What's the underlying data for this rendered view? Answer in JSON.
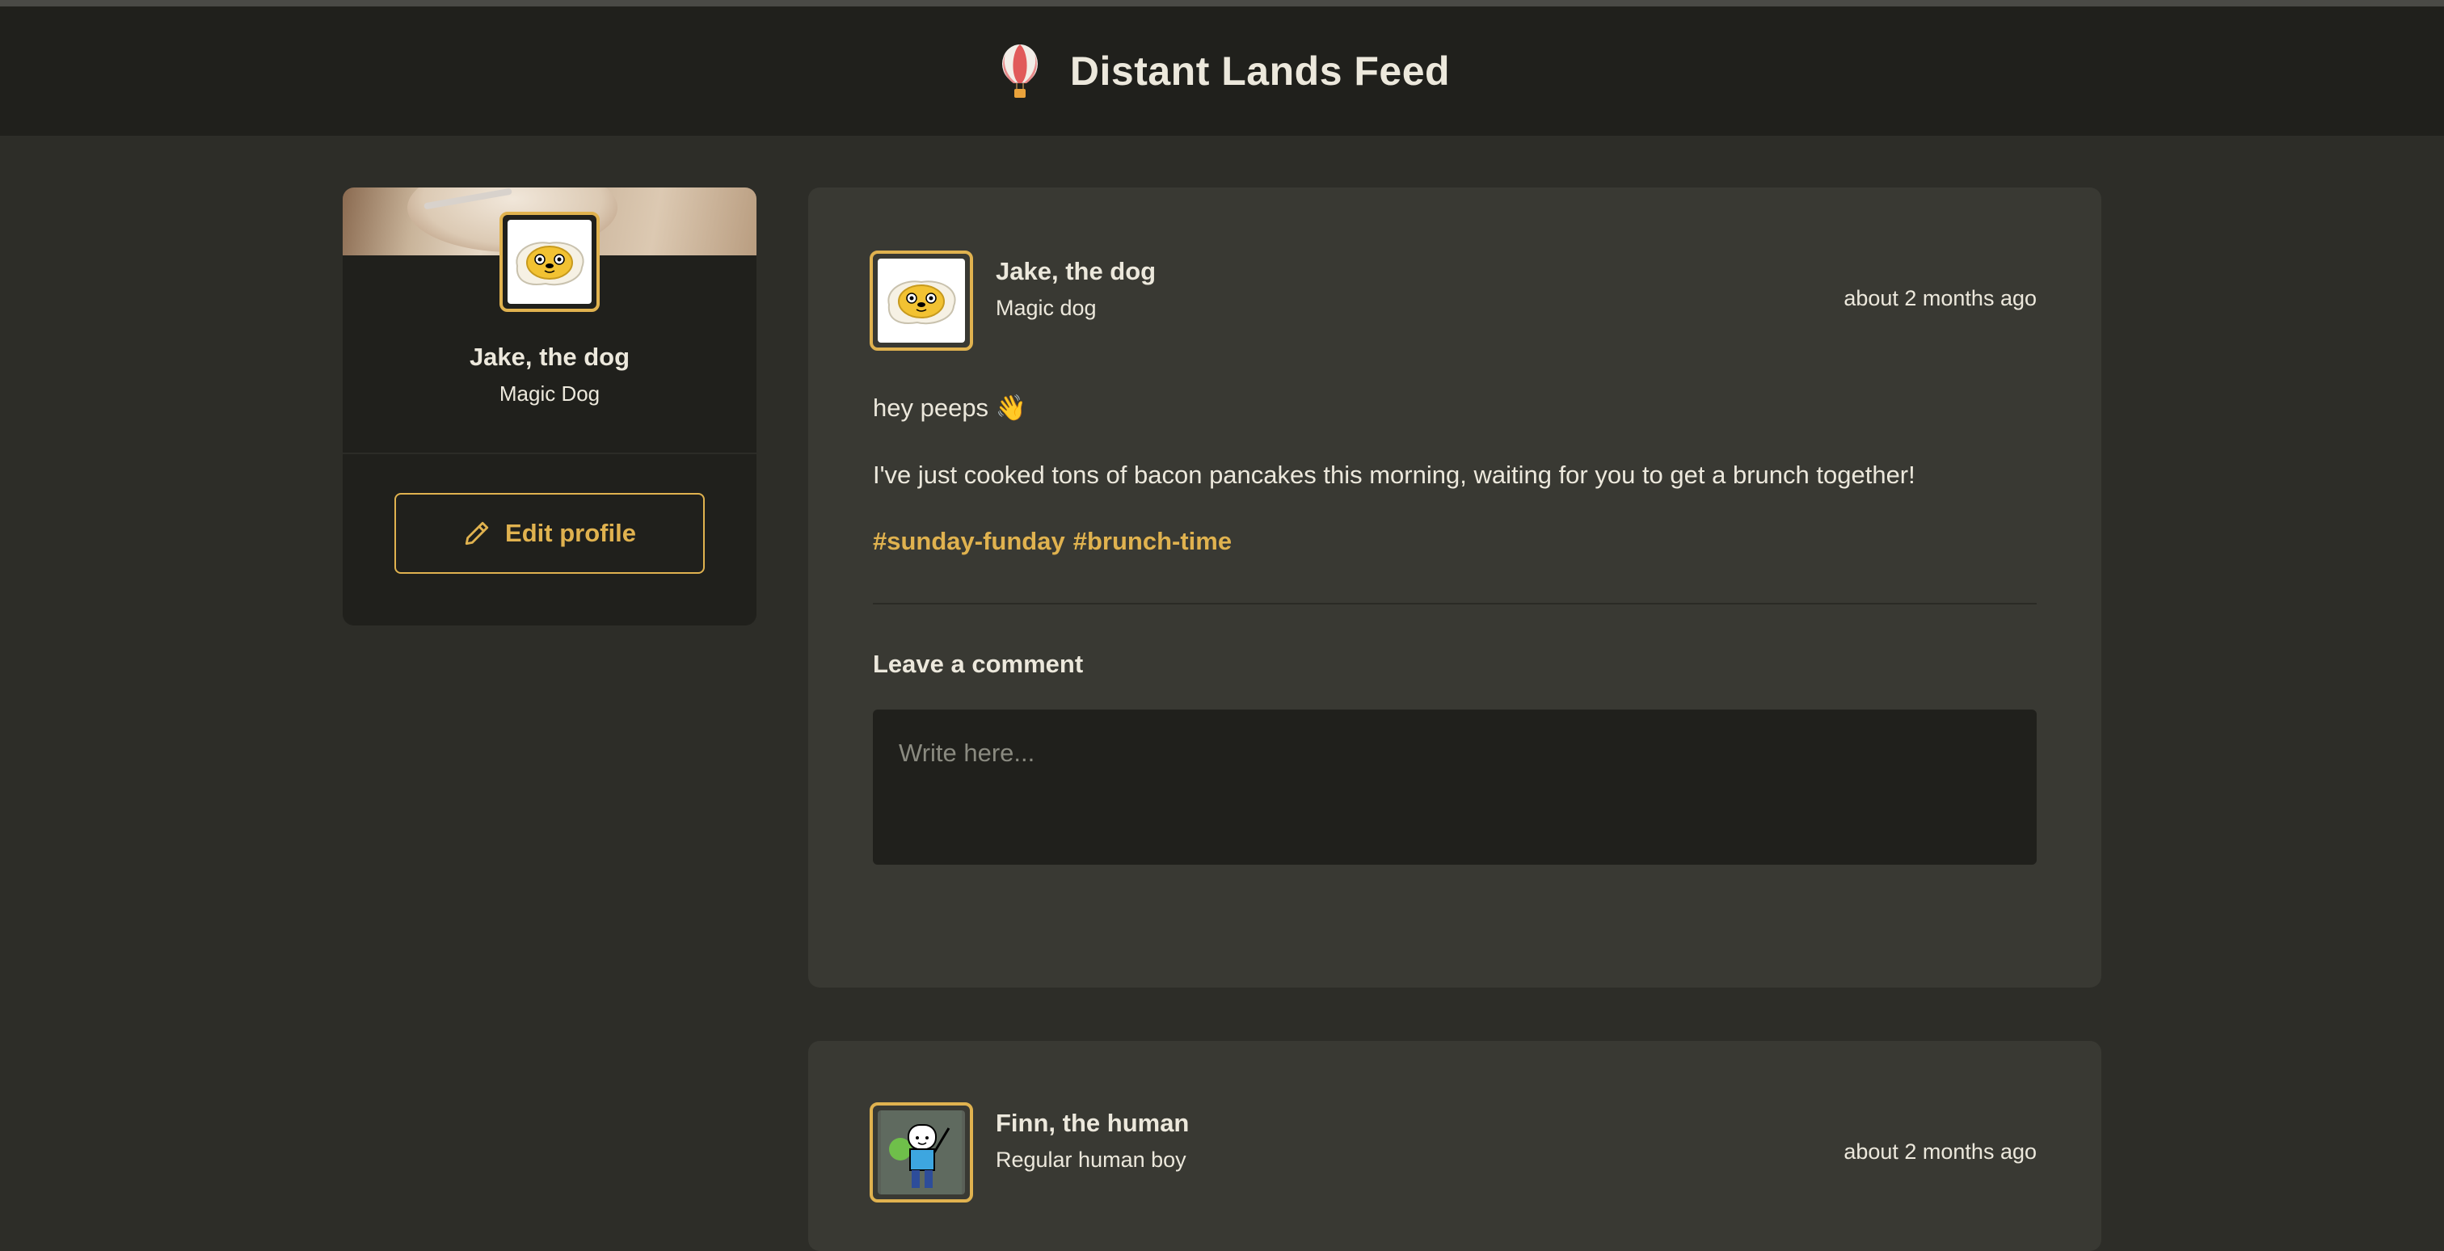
{
  "header": {
    "app_title": "Distant Lands Feed",
    "logo_icon": "hot-air-balloon-icon"
  },
  "profile": {
    "name": "Jake, the dog",
    "role": "Magic Dog",
    "edit_label": "Edit profile",
    "edit_icon": "pencil-icon",
    "avatar": "jake-egg-avatar"
  },
  "posts": [
    {
      "author": "Jake, the dog",
      "subtitle": "Magic dog",
      "time": "about 2 months ago",
      "lines": [
        "hey peeps 👋",
        "I've just cooked tons of bacon pancakes this morning, waiting for you to get a brunch together!"
      ],
      "tags": [
        "#sunday-funday",
        "#brunch-time"
      ],
      "comment_label": "Leave a comment",
      "comment_placeholder": "Write here..."
    },
    {
      "author": "Finn, the human",
      "subtitle": "Regular human boy",
      "time": "about 2 months ago"
    }
  ],
  "colors": {
    "background": "#2d2d28",
    "header": "#20201c",
    "card": "#393933",
    "accent": "#e0b24f",
    "text": "#ece8dc"
  }
}
